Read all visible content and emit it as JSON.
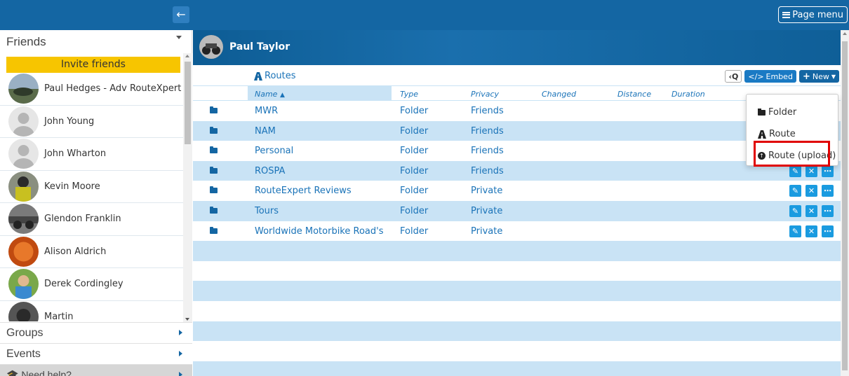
{
  "topbar": {
    "collapse_icon": "arrow-left-icon",
    "page_menu_label": "Page menu"
  },
  "sidebar": {
    "friends_header": "Friends",
    "invite_label": "Invite friends",
    "friends": [
      {
        "name": "Paul Hedges - Adv RouteXpert",
        "avatar_color": "#5a6b4a"
      },
      {
        "name": "John Young",
        "avatar_color": "#bdbdbd"
      },
      {
        "name": "John Wharton",
        "avatar_color": "#bdbdbd"
      },
      {
        "name": "Kevin Moore",
        "avatar_color": "#4a4a3a"
      },
      {
        "name": "Glendon Franklin",
        "avatar_color": "#6b6b6b"
      },
      {
        "name": "Alison Aldrich",
        "avatar_color": "#d9601a"
      },
      {
        "name": "Derek Cordingley",
        "avatar_color": "#6b9a3a"
      },
      {
        "name": "Martin",
        "avatar_color": "#3a3a3a"
      }
    ],
    "groups_label": "Groups",
    "events_label": "Events",
    "help_label": "Need help?"
  },
  "profile": {
    "name": "Paul Taylor"
  },
  "routes": {
    "title": "Routes",
    "toolbar": {
      "search_label": "‹Q",
      "embed_label": "Embed",
      "new_label": "New"
    },
    "columns": {
      "name": "Name",
      "type": "Type",
      "privacy": "Privacy",
      "changed": "Changed",
      "distance": "Distance",
      "duration": "Duration"
    },
    "rows": [
      {
        "name": "MWR",
        "type": "Folder",
        "privacy": "Friends"
      },
      {
        "name": "NAM",
        "type": "Folder",
        "privacy": "Friends"
      },
      {
        "name": "Personal",
        "type": "Folder",
        "privacy": "Friends"
      },
      {
        "name": "ROSPA",
        "type": "Folder",
        "privacy": "Friends"
      },
      {
        "name": "RouteExpert Reviews",
        "type": "Folder",
        "privacy": "Private"
      },
      {
        "name": "Tours",
        "type": "Folder",
        "privacy": "Private"
      },
      {
        "name": "Worldwide Motorbike Road's",
        "type": "Folder",
        "privacy": "Private"
      }
    ]
  },
  "new_menu": {
    "items": [
      {
        "label": "Folder",
        "icon": "folder-icon"
      },
      {
        "label": "Route",
        "icon": "road-icon"
      },
      {
        "label": "Route (upload)",
        "icon": "upload-icon"
      }
    ]
  },
  "colors": {
    "brand": "#1466a3",
    "accent": "#1a73b8",
    "row_alt": "#c9e3f5",
    "invite": "#f7c500",
    "highlight": "#e00000"
  }
}
